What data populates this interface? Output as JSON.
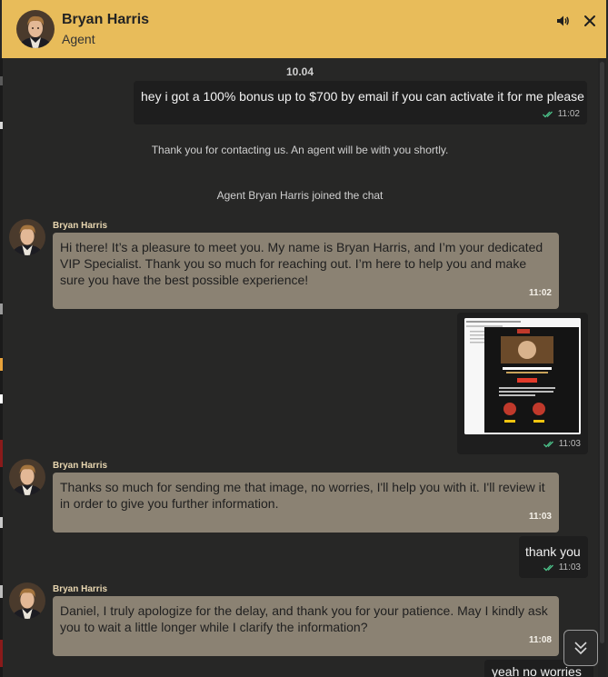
{
  "header": {
    "agent_name": "Bryan Harris",
    "agent_role": "Agent",
    "bg_color": "#e8bc5a",
    "sound_icon": "speaker-icon",
    "close_icon": "close-icon"
  },
  "chat": {
    "date_separator": "10.04",
    "messages": [
      {
        "type": "outgoing",
        "text": "hey i got a 100% bonus up to $700 by email if you can activate it for me please",
        "time": "11:02",
        "status": "read"
      },
      {
        "type": "system",
        "text": "Thank you for contacting us. An agent will be with you shortly."
      },
      {
        "type": "system",
        "text": "Agent Bryan Harris joined the chat"
      },
      {
        "type": "incoming",
        "sender": "Bryan Harris",
        "text": "Hi there! It’s a pleasure to meet you. My name is Bryan Harris, and I’m your dedicated VIP Specialist. Thank you so much for reaching out. I’m here to help you and make sure you have the best possible experience!",
        "time": "11:02"
      },
      {
        "type": "outgoing-image",
        "time": "11:03",
        "status": "read",
        "image_texts": {
          "headline": "250 spins or 100% boost",
          "cta": "CLAIM",
          "left_value": "250",
          "left_caption": "spins",
          "right_value": "100%",
          "right_caption": "boost"
        }
      },
      {
        "type": "incoming",
        "sender": "Bryan Harris",
        "text": "Thanks so much for sending me that image, no worries, I'll help you with it. I'll review it in order to give you further information.",
        "time": "11:03"
      },
      {
        "type": "outgoing",
        "text": "thank you",
        "time": "11:03",
        "status": "read"
      },
      {
        "type": "incoming",
        "sender": "Bryan Harris",
        "text": "Daniel, I truly apologize for the delay, and thank you for your patience. May I kindly ask you to wait a little longer while I clarify the information?",
        "time": "11:08"
      },
      {
        "type": "outgoing",
        "text": "yeah no worries",
        "time": "",
        "status": ""
      }
    ]
  },
  "colors": {
    "incoming_bubble": "#8b8273",
    "outgoing_bubble": "#1e1e1e",
    "read_check": "#4cc38a",
    "background": "#272726"
  },
  "scroll_down_icon": "double-chevron-down-icon"
}
